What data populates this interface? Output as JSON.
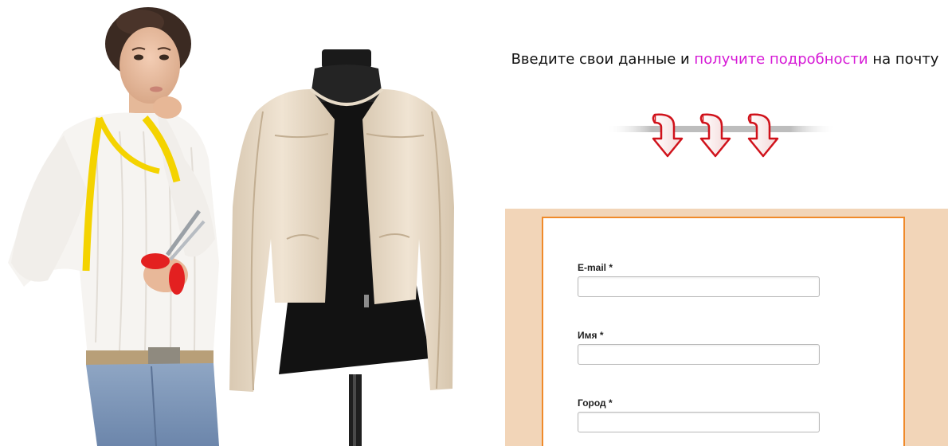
{
  "headline": {
    "part1": "Введите свои данные и ",
    "accent": "получите подробности",
    "part2": " на почту"
  },
  "colors": {
    "accent": "#d61ad6",
    "form_background": "#f2d5b8",
    "form_border": "#f08a2a",
    "arrow_red": "#d0121b"
  },
  "photo": {
    "subject": "seamstress-with-jacket-on-mannequin"
  },
  "form": {
    "fields": [
      {
        "label": "E-mail *",
        "value": "",
        "placeholder": ""
      },
      {
        "label": "Имя *",
        "value": "",
        "placeholder": ""
      },
      {
        "label": "Город *",
        "value": "",
        "placeholder": ""
      }
    ]
  }
}
